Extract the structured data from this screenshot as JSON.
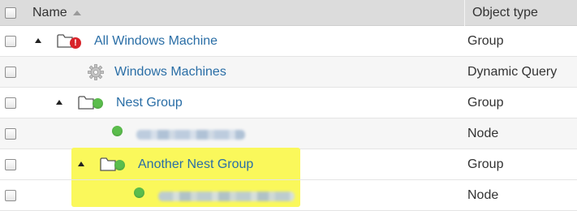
{
  "header": {
    "name_label": "Name",
    "type_label": "Object type",
    "sort_icon": "sort-ascending-icon"
  },
  "rows": [
    {
      "name": "All Windows Machine",
      "type": "Group",
      "icon": "folder-icon",
      "status": "error",
      "expanded": true
    },
    {
      "name": "Windows Machines",
      "type": "Dynamic Query",
      "icon": "gear-icon"
    },
    {
      "name": "Nest Group",
      "type": "Group",
      "icon": "folder-icon",
      "status": "up",
      "expanded": true
    },
    {
      "name": "",
      "type": "Node",
      "icon": "status-dot-icon",
      "status": "up",
      "obscured": true
    },
    {
      "name": "Another Nest Group",
      "type": "Group",
      "icon": "folder-icon",
      "status": "up",
      "expanded": true,
      "highlighted": true
    },
    {
      "name": "",
      "type": "Node",
      "icon": "status-dot-icon",
      "status": "up",
      "obscured": true,
      "highlighted": true
    }
  ],
  "colors": {
    "link": "#2a6ea6",
    "status_up": "#5bbd4c",
    "status_error": "#d8232a",
    "highlight": "#faf85b",
    "header_bg": "#dcdcdc"
  }
}
